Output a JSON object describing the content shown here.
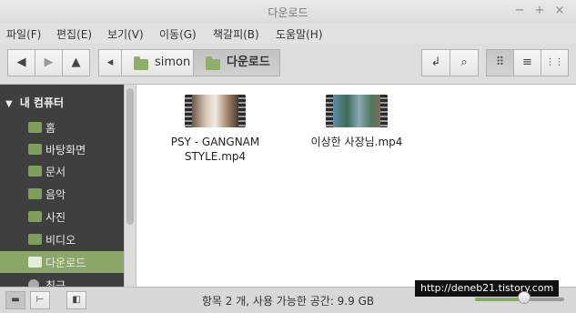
{
  "window": {
    "title": "다운로드"
  },
  "window_controls": {
    "minimize": "−",
    "maximize": "+",
    "close": "×"
  },
  "menu": [
    "파일(F)",
    "편집(E)",
    "보기(V)",
    "이동(G)",
    "책갈피(B)",
    "도움말(H)"
  ],
  "toolbar": {
    "back": "◀",
    "forward": "▶",
    "up": "▲",
    "crumb_toggle": "◂",
    "crumbs": [
      "simon",
      "다운로드"
    ],
    "toggle_location": "↲",
    "search": "⌕",
    "view_icons": "⠿",
    "view_list": "≡",
    "view_compact": "⋮⋮"
  },
  "sidebar": {
    "header": "내 컴퓨터",
    "items": [
      "홈",
      "바탕화면",
      "문서",
      "음악",
      "사진",
      "비디오",
      "다운로드",
      "최근"
    ],
    "active_index": 6
  },
  "files": [
    {
      "name_line1": "PSY - GANGNAM",
      "name_line2": "STYLE.mp4"
    },
    {
      "name_line1": "이상한 사장님.mp4",
      "name_line2": ""
    }
  ],
  "status": {
    "text": "항목 2 개, 사용 가능한 공간: 9.9 GB"
  },
  "watermark": "http://deneb21.tistory.com",
  "zoom": {
    "level_fraction": 0.55
  }
}
